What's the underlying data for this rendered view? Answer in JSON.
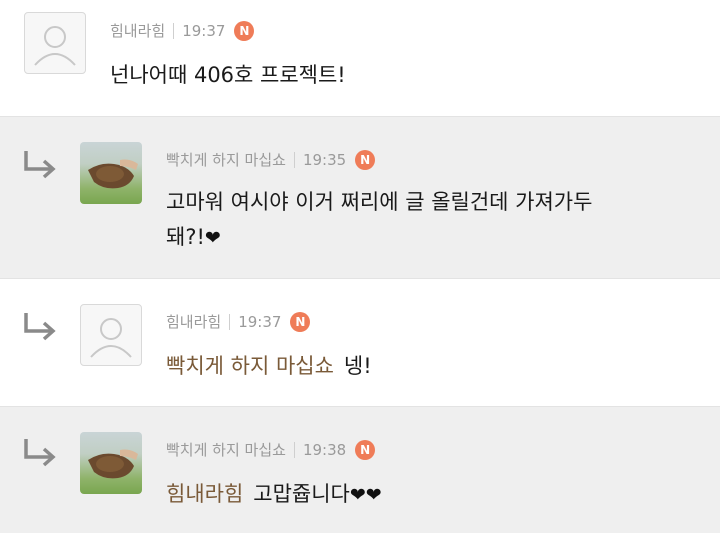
{
  "comments": [
    {
      "author": "힘내라힘",
      "time": "19:37",
      "badge": "N",
      "text": "넌나어때 406호 프로젝트!",
      "avatar": "default-user-icon",
      "is_reply": false
    },
    {
      "author": "빡치게 하지 마십쇼",
      "time": "19:35",
      "badge": "N",
      "text_line1": "고마워 여시야 이거 쩌리에 글 올릴건데 가져가두",
      "text_line2": "돼?!",
      "hearts": "❤",
      "avatar": "photo-hand-soil",
      "is_reply": true
    },
    {
      "author": "힘내라힘",
      "time": "19:37",
      "badge": "N",
      "mention": "빡치게 하지 마십쇼",
      "text": "넹!",
      "avatar": "default-user-icon",
      "is_reply": true
    },
    {
      "author": "빡치게 하지 마십쇼",
      "time": "19:38",
      "badge": "N",
      "mention": "힘내라힘",
      "text": "고맙쥽니다",
      "hearts": "❤❤",
      "avatar": "photo-hand-soil",
      "is_reply": true
    }
  ],
  "colors": {
    "badge": "#ef7c58",
    "mention": "#7a5a38",
    "reply_bg": "#efefef",
    "meta": "#9a9a9a"
  }
}
